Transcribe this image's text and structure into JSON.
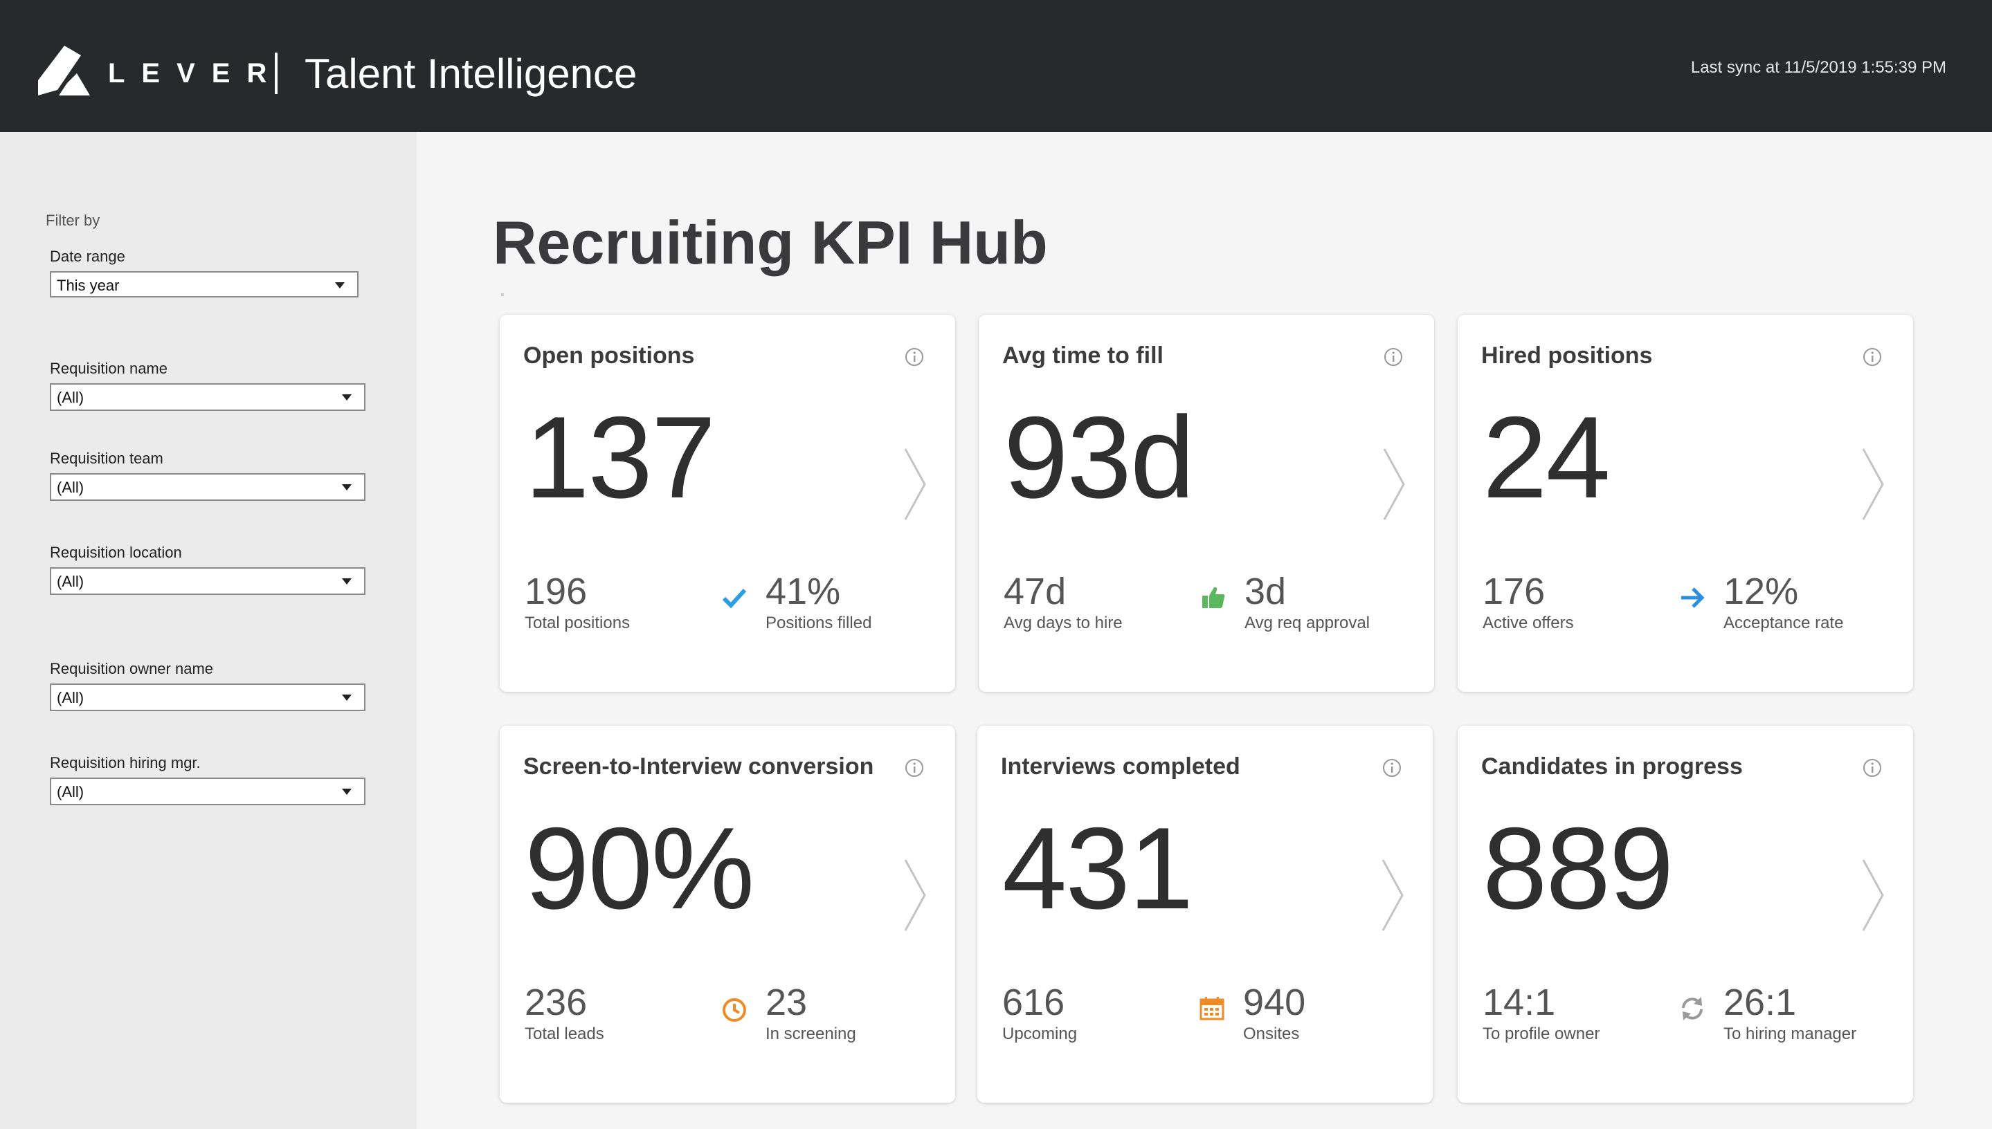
{
  "header": {
    "brand": "LEVER",
    "app_name": "Talent Intelligence",
    "last_sync": "Last sync at 11/5/2019 1:55:39 PM"
  },
  "sidebar": {
    "filter_by": "Filter by",
    "filters": [
      {
        "label": "Date range",
        "value": "This year"
      },
      {
        "label": "Requisition name",
        "value": "(All)"
      },
      {
        "label": "Requisition team",
        "value": "(All)"
      },
      {
        "label": "Requisition location",
        "value": "(All)"
      },
      {
        "label": "Requisition owner name",
        "value": "(All)"
      },
      {
        "label": "Requisition hiring mgr.",
        "value": "(All)"
      }
    ]
  },
  "page_title": "Recruiting KPI Hub",
  "cards": [
    {
      "title": "Open positions",
      "value": "137",
      "left_value": "196",
      "left_label": "Total positions",
      "right_value": "41%",
      "right_label": "Positions filled",
      "icon": "checkmark-icon",
      "icon_color": "#2d9fe0"
    },
    {
      "title": "Avg time to fill",
      "value": "93d",
      "left_value": "47d",
      "left_label": "Avg days to hire",
      "right_value": "3d",
      "right_label": "Avg req approval",
      "icon": "thumbs-up-icon",
      "icon_color": "#5cb85c"
    },
    {
      "title": "Hired positions",
      "value": "24",
      "left_value": "176",
      "left_label": "Active offers",
      "right_value": "12%",
      "right_label": "Acceptance rate",
      "icon": "arrow-right-icon",
      "icon_color": "#2d8fe0"
    },
    {
      "title": "Screen-to-Interview conversion",
      "value": "90%",
      "left_value": "236",
      "left_label": "Total leads",
      "right_value": "23",
      "right_label": "In screening",
      "icon": "clock-icon",
      "icon_color": "#f08a24"
    },
    {
      "title": "Interviews completed",
      "value": "431",
      "left_value": "616",
      "left_label": "Upcoming",
      "right_value": "940",
      "right_label": "Onsites",
      "icon": "calendar-icon",
      "icon_color": "#f08a24"
    },
    {
      "title": "Candidates in progress",
      "value": "889",
      "left_value": "14:1",
      "left_label": "To profile owner",
      "right_value": "26:1",
      "right_label": "To hiring manager",
      "icon": "refresh-icon",
      "icon_color": "#9a9a9a"
    }
  ]
}
